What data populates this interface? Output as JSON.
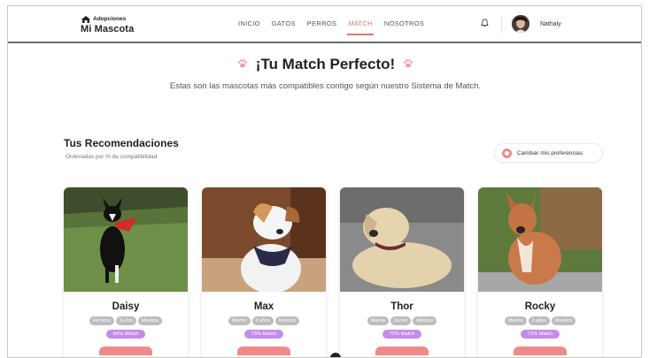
{
  "brand": {
    "line1": "Adopciones",
    "line2": "Mi Mascota"
  },
  "nav": {
    "items": [
      {
        "label": "INICIO",
        "active": false
      },
      {
        "label": "GATOS",
        "active": false
      },
      {
        "label": "PERROS",
        "active": false
      },
      {
        "label": "MATCH",
        "active": true
      },
      {
        "label": "NOSOTROS",
        "active": false
      }
    ],
    "accent_color": "#e57373"
  },
  "user": {
    "name": "Nathaly"
  },
  "hero": {
    "title": "¡Tu Match Perfecto!",
    "subtitle": "Estas son las mascotas más compatibles contigo según nuestro Sistema de Match."
  },
  "recommendations": {
    "title": "Tus Recomendaciones",
    "subtitle": "Ordenadas por % de compatibilidad",
    "prefs_button": "Cambiar mis preferencias"
  },
  "pets": [
    {
      "name": "Daisy",
      "tags": [
        "Hembra",
        "1a 6m",
        "Mestiza"
      ],
      "match": "84% Match"
    },
    {
      "name": "Max",
      "tags": [
        "Macho",
        "2 años",
        "Mestizo"
      ],
      "match": "73% Match"
    },
    {
      "name": "Thor",
      "tags": [
        "Macho",
        "2a 6m",
        "Mestizo"
      ],
      "match": "72% Match"
    },
    {
      "name": "Rocky",
      "tags": [
        "Macho",
        "3 años",
        "Mestizo"
      ],
      "match": "71% Match"
    }
  ],
  "colors": {
    "match_badge": "#c58be8",
    "tag": "#bdbdbd",
    "primary_button": "#f08a8a"
  }
}
